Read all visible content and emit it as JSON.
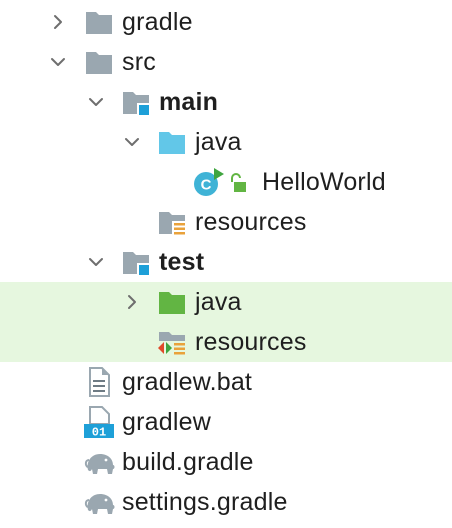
{
  "project_tree": {
    "items": [
      {
        "label": "gradle",
        "expanded": false,
        "icon": "folder-icon",
        "bold": false
      },
      {
        "label": "src",
        "expanded": true,
        "icon": "folder-icon",
        "bold": false
      },
      {
        "label": "main",
        "expanded": true,
        "icon": "module-folder-icon",
        "bold": true
      },
      {
        "label": "java",
        "expanded": true,
        "icon": "source-root-folder-icon",
        "bold": false
      },
      {
        "label": "HelloWorld",
        "icon": "java-class-runnable-icon",
        "bold": false
      },
      {
        "label": "resources",
        "icon": "resources-folder-icon",
        "bold": false
      },
      {
        "label": "test",
        "expanded": true,
        "icon": "module-folder-icon",
        "bold": true
      },
      {
        "label": "java",
        "expanded": false,
        "icon": "test-source-root-folder-icon",
        "bold": false,
        "highlighted": true
      },
      {
        "label": "resources",
        "icon": "test-resources-folder-icon",
        "bold": false,
        "highlighted": true
      },
      {
        "label": "gradlew.bat",
        "icon": "text-file-icon",
        "bold": false
      },
      {
        "label": "gradlew",
        "icon": "binary-file-icon",
        "bold": false
      },
      {
        "label": "build.gradle",
        "icon": "gradle-elephant-icon",
        "bold": false
      },
      {
        "label": "settings.gradle",
        "icon": "gradle-elephant-icon",
        "bold": false
      }
    ]
  },
  "colors": {
    "folder_gray": "#9aa7b0",
    "source_root_blue": "#62c7e8",
    "test_source_green": "#62b543",
    "module_marker_blue": "#1ea0d8",
    "highlight_green": "#e6f7df",
    "chevron_gray": "#6e6e6e"
  }
}
